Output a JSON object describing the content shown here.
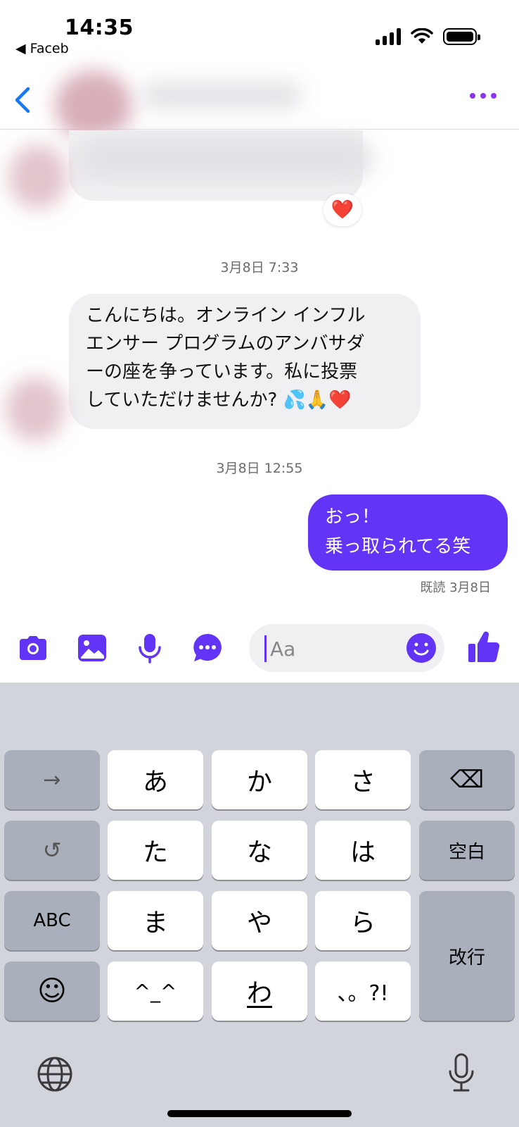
{
  "status_bar": {
    "time": "14:35",
    "back_app": "◀ Faceb"
  },
  "conversation": {
    "timestamp_1": "3月8日 7:33",
    "message_in": {
      "lines": [
        "こんにちは。オンライン インフル",
        "エンサー プログラムのアンバサダ",
        "ーの座を争っています。私に投票",
        "していただけませんか? 💦🙏❤️"
      ]
    },
    "timestamp_2": "3月8日 12:55",
    "message_out": {
      "lines": [
        "おっ！",
        "乗っ取られてる笑"
      ]
    },
    "read_receipt": "既読 3月8日",
    "reaction": "❤️"
  },
  "composer": {
    "placeholder": "Aa"
  },
  "keyboard": {
    "row1": [
      "→",
      "あ",
      "か",
      "さ",
      "⌫"
    ],
    "row2": [
      "↺",
      "た",
      "な",
      "は",
      "空白"
    ],
    "row3": [
      "ABC",
      "ま",
      "や",
      "ら",
      "改行"
    ],
    "row4": [
      "☺",
      "^_^",
      "わ",
      "、。?!"
    ]
  },
  "colors": {
    "accent": "#6234f6",
    "header_accent": "#8a35f0",
    "incoming_bubble": "#f0f0f3"
  }
}
